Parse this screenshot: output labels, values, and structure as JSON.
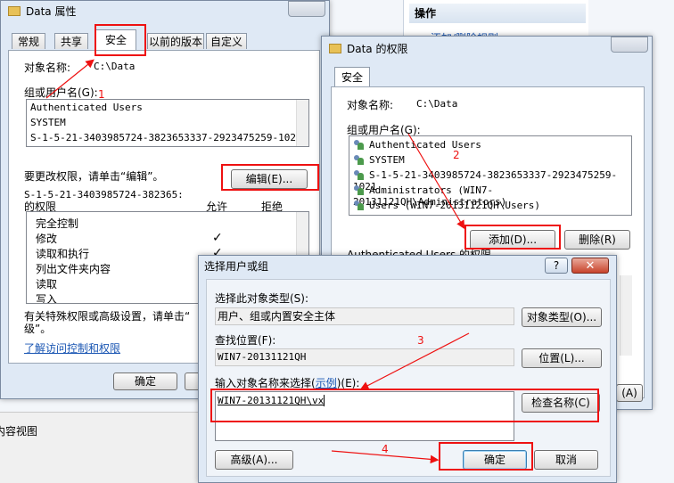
{
  "background": {
    "actions_title": "操作",
    "actions_link": "添加/删除规则",
    "bottom_left_text": "内容视图"
  },
  "data_props": {
    "title": "Data 属性",
    "tabs": [
      "常规",
      "共享",
      "安全",
      "以前的版本",
      "自定义"
    ],
    "object_label": "对象名称:",
    "object_value": "C:\\Data",
    "group_label": "组或用户名(G):",
    "users": [
      "Authenticated Users",
      "SYSTEM",
      "S-1-5-21-3403985724-3823653337-2923475259-1021"
    ],
    "change_perm_text": "要更改权限，请单击“编辑”。",
    "edit_button": "编辑(E)...",
    "perm_for": "S-1-5-21-3403985724-382365:",
    "perm_of": "的权限",
    "allow": "允许",
    "deny": "拒绝",
    "perms": [
      "完全控制",
      "修改",
      "读取和执行",
      "列出文件夹内容",
      "读取",
      "写入"
    ],
    "perm_checks": [
      "",
      "✓",
      "✓",
      "",
      "",
      ""
    ],
    "special_text_1": "有关特殊权限或高级设置，请单击“",
    "special_text_2": "级”。",
    "learn_link": "了解访问控制和权限",
    "ok_button": "确定"
  },
  "perm_dialog": {
    "title": "Data 的权限",
    "tab": "安全",
    "object_label": "对象名称:",
    "object_value": "C:\\Data",
    "group_label": "组或用户名(G):",
    "users": [
      "Authenticated Users",
      "SYSTEM",
      "S-1-5-21-3403985724-3823653337-2923475259-1021",
      "Administrators (WIN7-20131121QH\\Administrators)",
      "Users (WIN7-20131121QH\\Users)"
    ],
    "add_button": "添加(D)...",
    "remove_button": "删除(R)",
    "perm_label": "Authenticated Users 的权限",
    "apply_button": "(A)"
  },
  "select_dialog": {
    "title": "选择用户或组",
    "help": "?",
    "close": "✕",
    "object_type_label": "选择此对象类型(S):",
    "object_type_value": "用户、组或内置安全主体",
    "object_type_button": "对象类型(O)...",
    "location_label": "查找位置(F):",
    "location_value": "WIN7-20131121QH",
    "location_button": "位置(L)...",
    "enter_label_prefix": "输入对象名称来选择(",
    "enter_label_link": "示例",
    "enter_label_suffix": ")(E):",
    "enter_value": "WIN7-20131121QH\\vx",
    "check_names_button": "检查名称(C)",
    "advanced_button": "高级(A)...",
    "ok_button": "确定",
    "cancel_button": "取消"
  },
  "annotations": [
    "1",
    "2",
    "3",
    "4"
  ]
}
